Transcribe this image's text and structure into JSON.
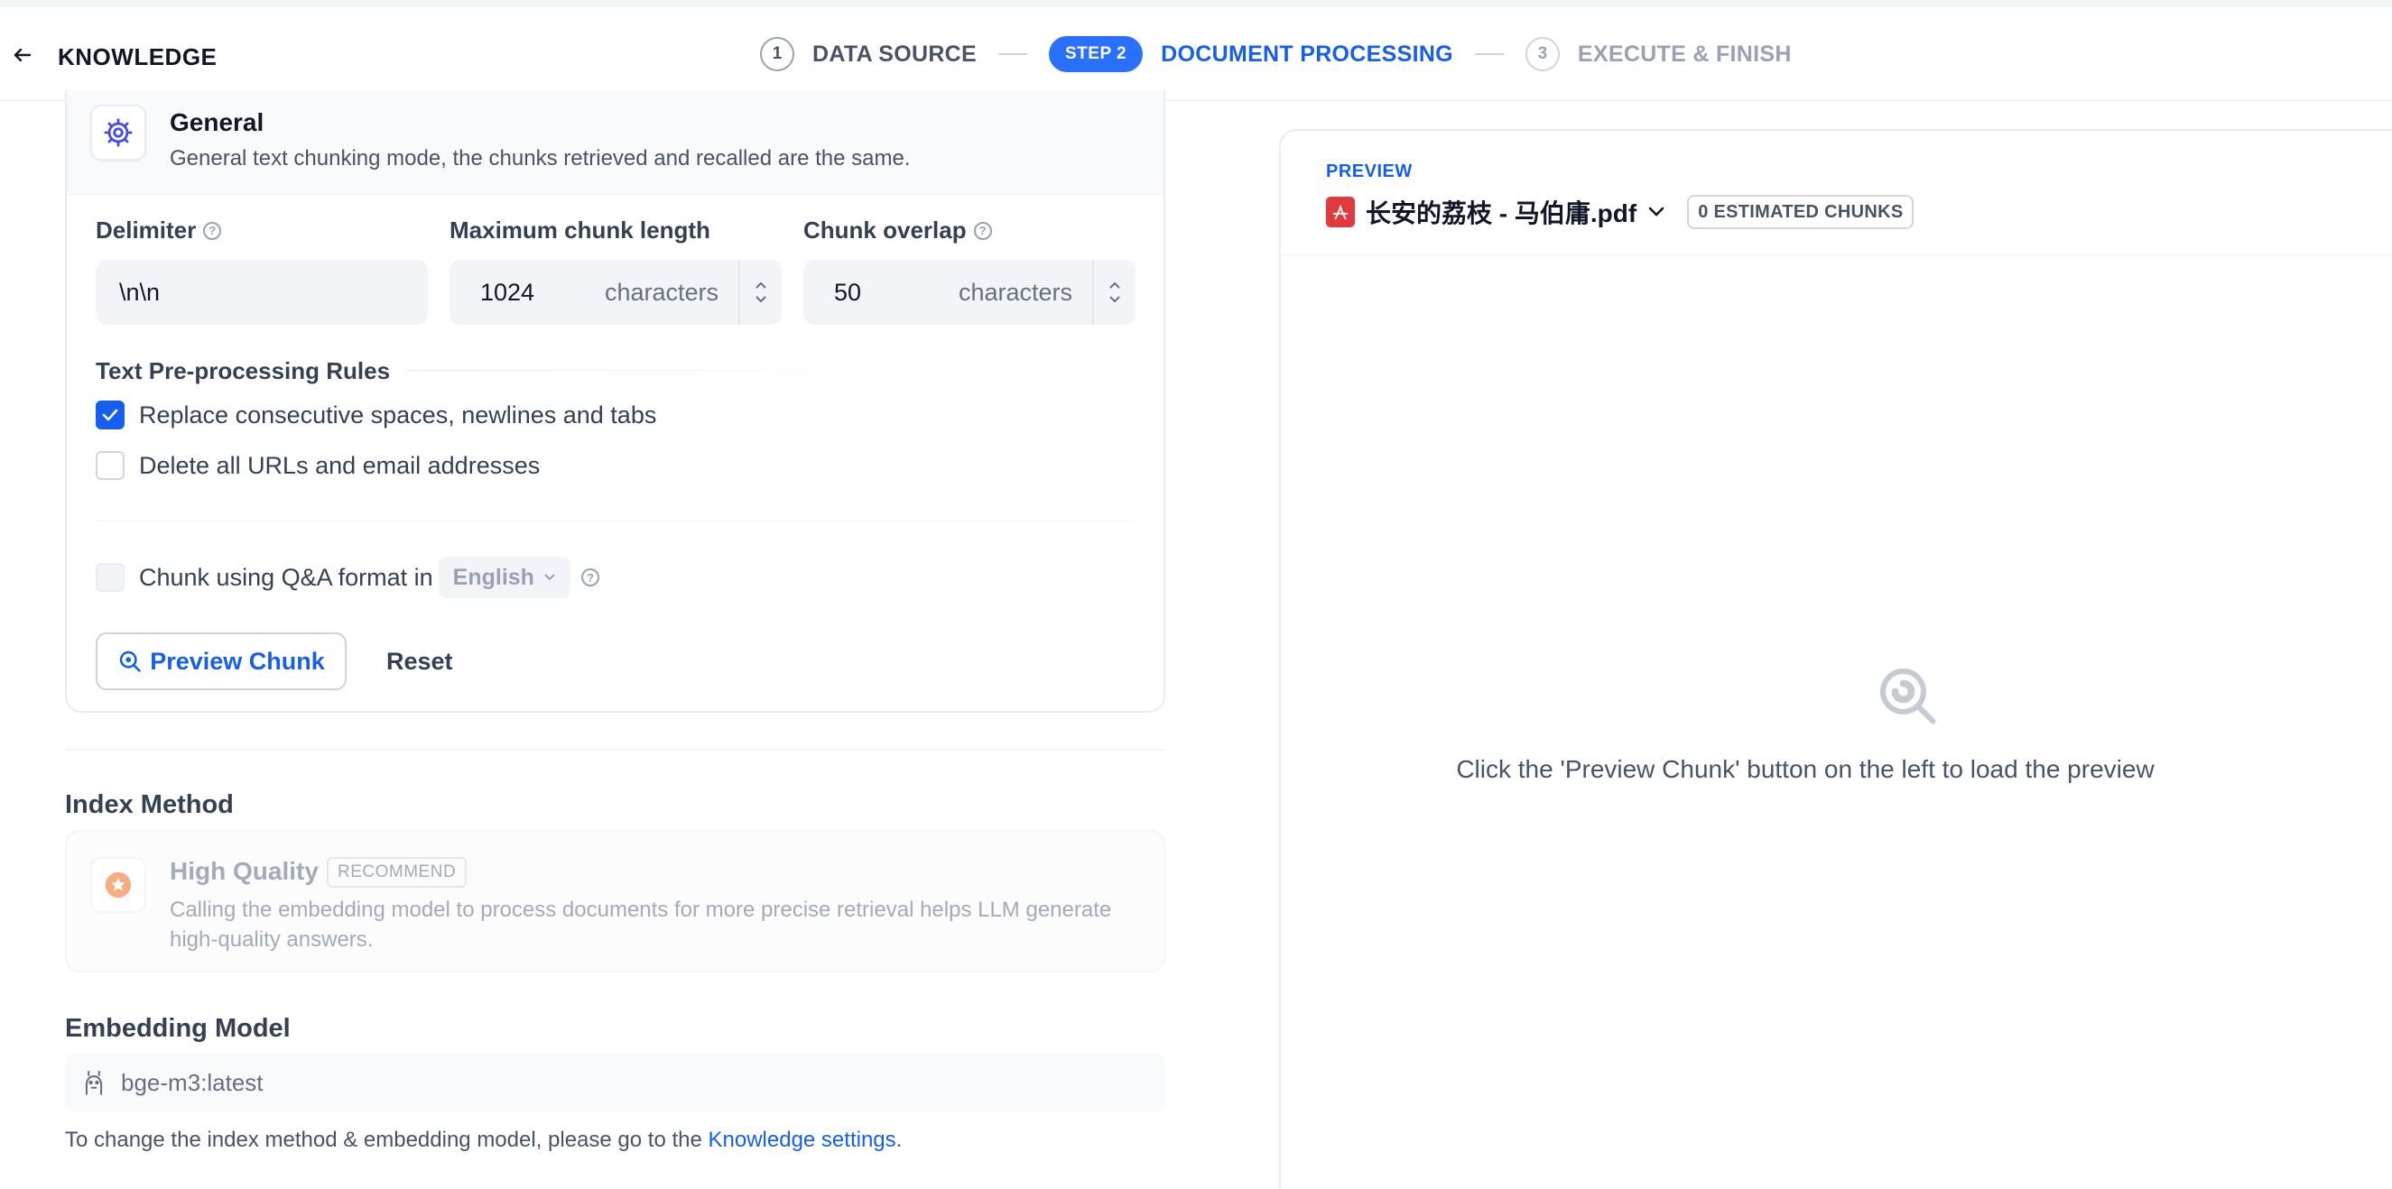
{
  "header": {
    "title": "KNOWLEDGE",
    "steps": [
      {
        "number": "1",
        "label": "DATA SOURCE"
      },
      {
        "number": "STEP 2",
        "label": "DOCUMENT PROCESSING"
      },
      {
        "number": "3",
        "label": "EXECUTE & FINISH"
      }
    ]
  },
  "general": {
    "title": "General",
    "description": "General text chunking mode, the chunks retrieved and recalled are the same.",
    "delimiter": {
      "label": "Delimiter",
      "value": "\\n\\n"
    },
    "max_chunk": {
      "label": "Maximum chunk length",
      "value": "1024",
      "unit": "characters"
    },
    "overlap": {
      "label": "Chunk overlap",
      "value": "50",
      "unit": "characters"
    },
    "rules_title": "Text Pre-processing Rules",
    "rules": [
      {
        "label": "Replace consecutive spaces, newlines and tabs",
        "checked": true
      },
      {
        "label": "Delete all URLs and email addresses",
        "checked": false
      }
    ],
    "qa": {
      "label": "Chunk using Q&A format in",
      "language": "English"
    },
    "preview_button": "Preview Chunk",
    "reset_button": "Reset"
  },
  "index_method": {
    "title": "Index Method",
    "option_title": "High Quality",
    "badge": "RECOMMEND",
    "option_desc": "Calling the embedding model to process documents for more precise retrieval helps LLM generate high-quality answers."
  },
  "embedding": {
    "title": "Embedding Model",
    "model": "bge-m3:latest",
    "note_prefix": "To change the index method & embedding model, please go to the ",
    "note_link": "Knowledge settings",
    "note_suffix": "."
  },
  "preview": {
    "label": "PREVIEW",
    "file_name": "长安的荔枝 - 马伯庸.pdf",
    "chunks_badge": "0 ESTIMATED CHUNKS",
    "empty_text": "Click the 'Preview Chunk' button on the left to load the preview"
  },
  "colors": {
    "accent": "#155eef",
    "step_pill": "#2970ff",
    "pdf_red": "#e0393e",
    "index_icon": "#f38744"
  }
}
